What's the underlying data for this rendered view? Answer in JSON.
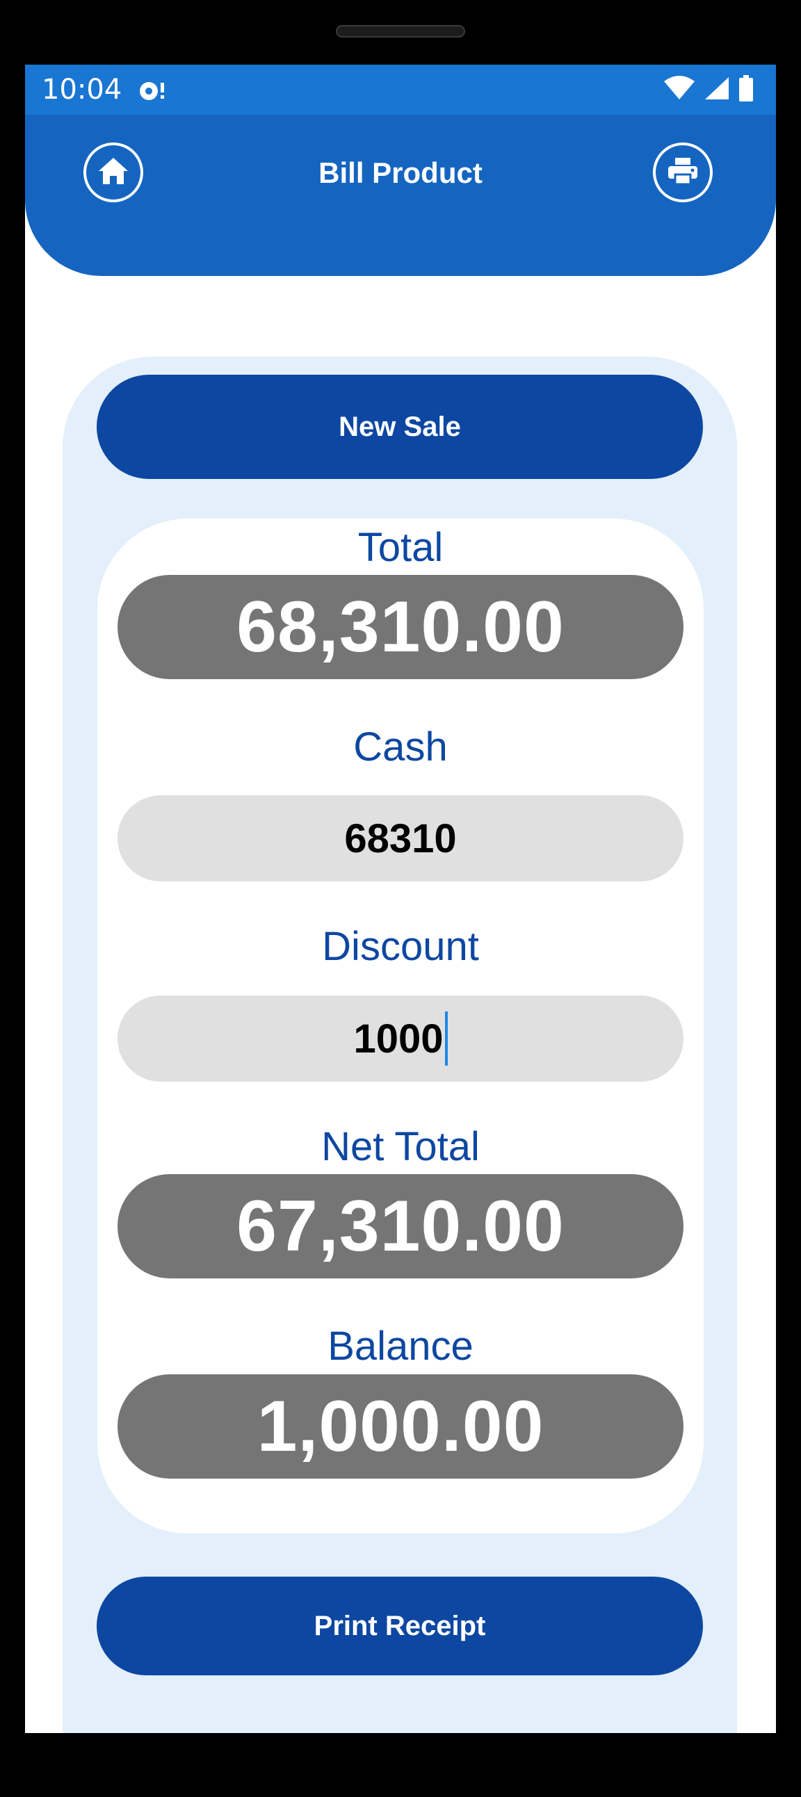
{
  "status_bar": {
    "time": "10:04",
    "icons": [
      "notification-icon",
      "wifi-icon",
      "signal-icon",
      "battery-icon"
    ]
  },
  "app_bar": {
    "title": "Bill Product",
    "left_icon": "home-icon",
    "right_icon": "print-icon"
  },
  "actions": {
    "new_sale": "New Sale",
    "print_receipt": "Print Receipt"
  },
  "fields": {
    "total_label": "Total",
    "total_value": "68,310.00",
    "cash_label": "Cash",
    "cash_value": "68310",
    "discount_label": "Discount",
    "discount_value": "1000",
    "net_total_label": "Net Total",
    "net_total_value": "67,310.00",
    "balance_label": "Balance",
    "balance_value": "1,000.00"
  },
  "colors": {
    "status_bar": "#1976d2",
    "app_bar": "#1565c0",
    "primary_button": "#0d47a1",
    "label_text": "#0d47a1",
    "panel_background": "#e3effb",
    "value_pill": "#757575",
    "input_pill": "#e0e0e0",
    "cursor": "#1e88e5"
  }
}
